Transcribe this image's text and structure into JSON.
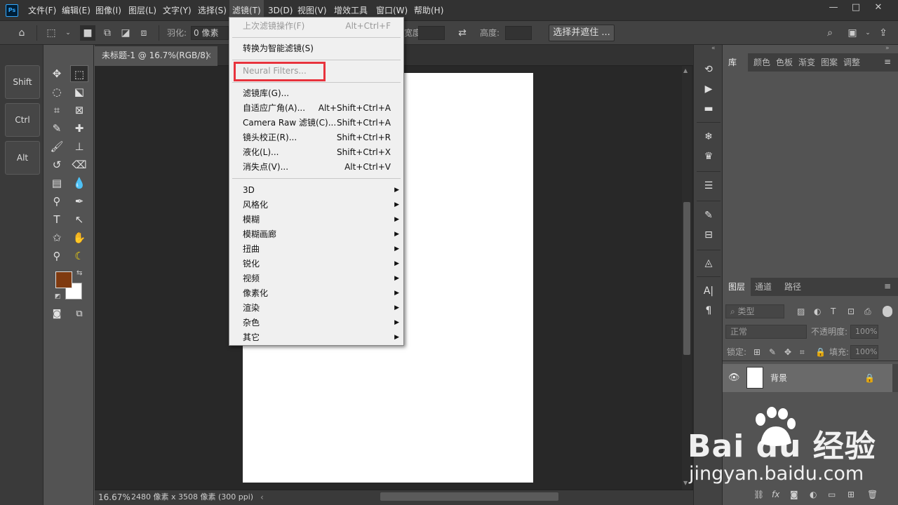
{
  "app": {
    "logo": "Ps"
  },
  "menubar": {
    "items": [
      "文件(F)",
      "编辑(E)",
      "图像(I)",
      "图层(L)",
      "文字(Y)",
      "选择(S)",
      "滤镜(T)",
      "3D(D)",
      "视图(V)",
      "增效工具",
      "窗口(W)",
      "帮助(H)"
    ],
    "active": "滤镜(T)",
    "window_controls": [
      "—",
      "□",
      "✕"
    ]
  },
  "options_bar": {
    "feather_label": "羽化:",
    "feather_value": "0 像素",
    "width_label": "宽度:",
    "height_label": "高度:",
    "select_mask_button": "选择并遮住 ..."
  },
  "shortcut_panel": {
    "keys": [
      "Shift",
      "Ctrl",
      "Alt"
    ]
  },
  "colors": {
    "foreground": "#7f3a10",
    "background": "#ffffff",
    "highlight": "#e8333d"
  },
  "document": {
    "tab_title": "未标题-1 @ 16.7%(RGB/8)",
    "tab_close": "×",
    "zoom": "16.67%",
    "doc_info": "2480 像素 x 3508 像素 (300 ppi)"
  },
  "filter_menu": {
    "last_filter": {
      "label": "上次滤镜操作(F)",
      "shortcut": "Alt+Ctrl+F"
    },
    "smart_filter": {
      "label": "转换为智能滤镜(S)"
    },
    "neural_filters": {
      "label": "Neural Filters..."
    },
    "group1": [
      {
        "label": "滤镜库(G)...",
        "shortcut": ""
      },
      {
        "label": "自适应广角(A)...",
        "shortcut": "Alt+Shift+Ctrl+A"
      },
      {
        "label": "Camera Raw 滤镜(C)...",
        "shortcut": "Shift+Ctrl+A"
      },
      {
        "label": "镜头校正(R)...",
        "shortcut": "Shift+Ctrl+R"
      },
      {
        "label": "液化(L)...",
        "shortcut": "Shift+Ctrl+X"
      },
      {
        "label": "消失点(V)...",
        "shortcut": "Alt+Ctrl+V"
      }
    ],
    "submenus": [
      "3D",
      "风格化",
      "模糊",
      "模糊画廊",
      "扭曲",
      "锐化",
      "视频",
      "像素化",
      "渲染",
      "杂色",
      "其它"
    ]
  },
  "library_panel": {
    "tabs": [
      "库",
      "颜色",
      "色板",
      "渐变",
      "图案",
      "调整"
    ]
  },
  "layers_panel": {
    "tabs": [
      "图层",
      "通道",
      "路径"
    ],
    "filter_kind": "类型",
    "blend_mode": "正常",
    "opacity_label": "不透明度:",
    "opacity_value": "100%",
    "lock_label": "锁定:",
    "fill_label": "填充:",
    "fill_value": "100%",
    "layer_name": "背景"
  },
  "watermark": {
    "brand": "Bai du 经验",
    "url": "jingyan.baidu.com"
  }
}
